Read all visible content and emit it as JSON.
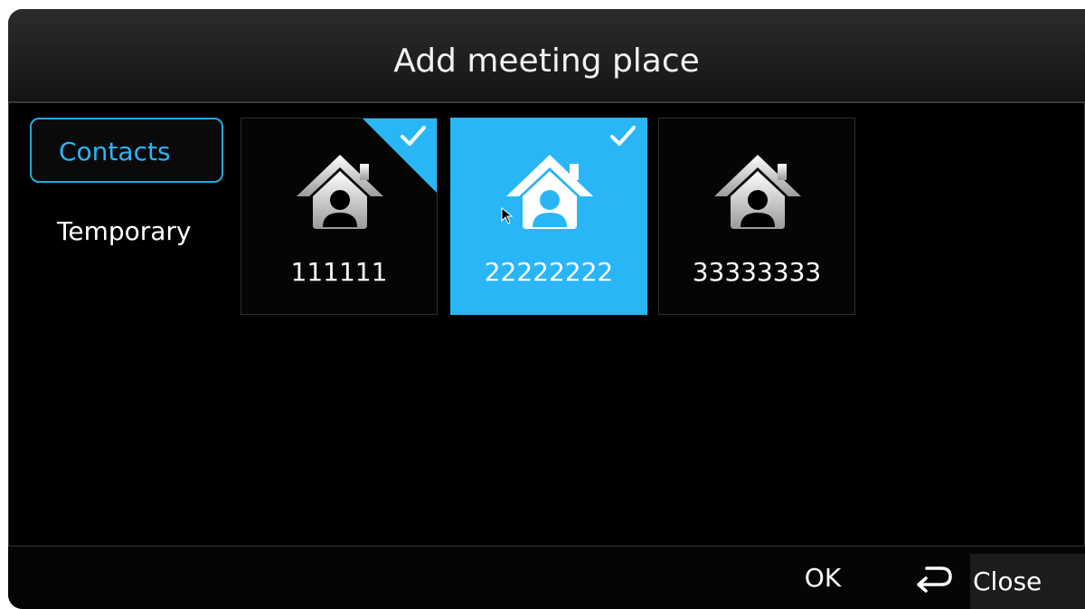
{
  "dialog": {
    "title": "Add meeting place"
  },
  "tabs": [
    {
      "label": "Contacts",
      "active": true
    },
    {
      "label": "Temporary",
      "active": false
    }
  ],
  "places": [
    {
      "label": "111111",
      "checked": true,
      "focused": false
    },
    {
      "label": "22222222",
      "checked": true,
      "focused": true
    },
    {
      "label": "33333333",
      "checked": false,
      "focused": false
    }
  ],
  "footer": {
    "ok_label": "OK",
    "close_label": "Close"
  },
  "icons": {
    "place": "house-contact-icon",
    "check": "checkmark-icon",
    "return": "return-arrow-icon"
  },
  "colors": {
    "accent": "#29b6f6",
    "background": "#000000",
    "title_bar": "#1e1e1e"
  }
}
